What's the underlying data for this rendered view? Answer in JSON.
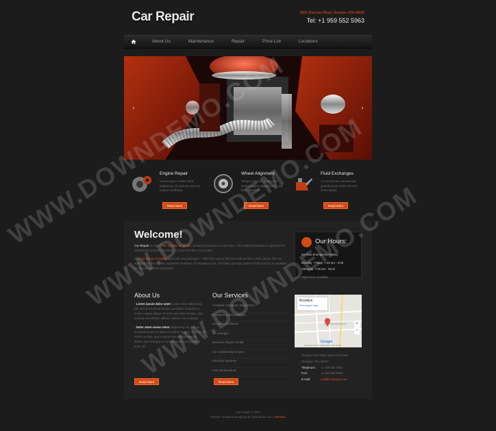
{
  "header": {
    "logo": "Car Repair",
    "address": "8901 Marmora Road, Glasgow, D04 89GR",
    "phone": "Tel: +1 959 552 5963"
  },
  "nav": {
    "items": [
      "About Us",
      "Maintenance",
      "Repair",
      "Price List",
      "Locations"
    ]
  },
  "slider": {
    "prev": "‹",
    "next": "›"
  },
  "features": [
    {
      "title": "Engine Repair",
      "text": "Lorem ipsum consec tetur adipiscing elit, sed do eiusmod tempor incididunt.",
      "button": "Read More"
    },
    {
      "title": "Wheel Alignment",
      "text": "Tempor incidunt ut labore et dolore magna aliquam erat, sed diam volutpat.",
      "button": "Read More"
    },
    {
      "title": "Fluid Exchanges",
      "text": "Ac est ultricies vehicula vel gravida ipsum dolor sit amet lorem ipsum.",
      "button": "Read More"
    }
  ],
  "welcome": {
    "title": "Welcome!",
    "p1_lead": "Car Repair",
    "p1_a": " is one of ",
    "p1_link": "free website templates",
    "p1_b": " created by downdemo.com team. This website template is optimized for 1280X1024 screen resolution. It is also XHTML & CSS valid.",
    "p2_a": "The ",
    "p2_link": "Car Repair Template",
    "p2_b": " goes with two packages – with PSD source files and without them. PSD source files are available for free for the registered members of Templates.com. The basic package (without PSD source) is available for anyone without registration."
  },
  "hours": {
    "title": "Our Hours:",
    "line1": "24 Hour Emergency Towing",
    "line2": "Monday - Friday: 7:30 am - 6:00",
    "line3": "Saturday: 7:30 am - Noon",
    "line4": "Night Drop Available"
  },
  "about": {
    "title": "About Us",
    "item1_lead": "Lorem ipsum dolor amet",
    "item1_text": " consec tetur adipisicing elit, sed do eiusmod tempor incididunt ut labore et dolore magna aliqua. Ut enim ad minim veniam, quis nostrud exercitation ullamco laboris nisi ut aliquip.",
    "item2_lead": "Dolor amet conse ctetur",
    "item2_text": " adipisicing elit, sed do eiusmod tempor ut labore et dolore magna. Ut enim ad minim veniam, quis nostrud exercitation ullamco laboris nisi ut aliquip ex ea commodo consequat ut enim ad.",
    "button": "Read More"
  },
  "services": {
    "title": "Our Services",
    "items": [
      "Complete Computer Diagnostics",
      "Complete Safety Analysis",
      "Drivability Problems",
      "Oil Changes",
      "Emission Repair Facility",
      "Air Conditioning Service",
      "Electrical Systems",
      "Fleet Maintenance"
    ],
    "button": "Read More"
  },
  "map": {
    "place": "Brooklyn",
    "link": "View larger map",
    "area": "CROWN HEIGHTS",
    "brand": "Google",
    "footer": "Keyboard shortcuts   Map Data   Terms of Use"
  },
  "contact": {
    "address1": "Glasgow d04 89GR Marmora Road,",
    "address2": "Glasgow, D04 89GR",
    "telephone_label": "Telephone:",
    "telephone": "+1 959 552 5963",
    "fax_label": "FAX:",
    "fax": "+1 959 552 5963",
    "email_label": "E-mail:",
    "email": "mail@company.com"
  },
  "footer": {
    "line1": "Car Repair © 2012",
    "line2": "Website Template Designed by downdemo.com | ",
    "line2_link": "Website"
  },
  "watermark": "WWW.DOWNDEMO.COM",
  "colors": {
    "accent": "#d54a15",
    "background": "#1c1c1c",
    "panel": "#222222"
  }
}
